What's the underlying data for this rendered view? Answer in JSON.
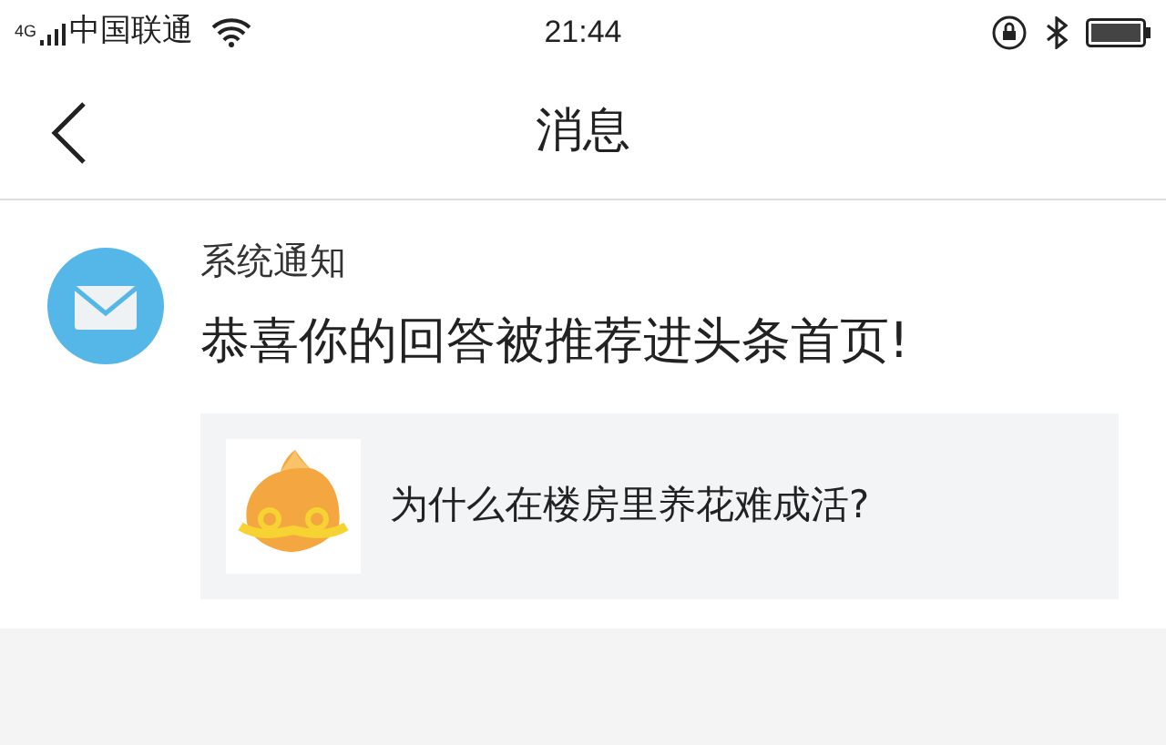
{
  "status_bar": {
    "network": "4G",
    "carrier": "中国联通",
    "time": "21:44"
  },
  "nav_bar": {
    "title": "消息"
  },
  "message": {
    "sender": "系统通知",
    "text": "恭喜你的回答被推荐进头条首页!",
    "card": {
      "title": "为什么在楼房里养花难成活?"
    }
  }
}
